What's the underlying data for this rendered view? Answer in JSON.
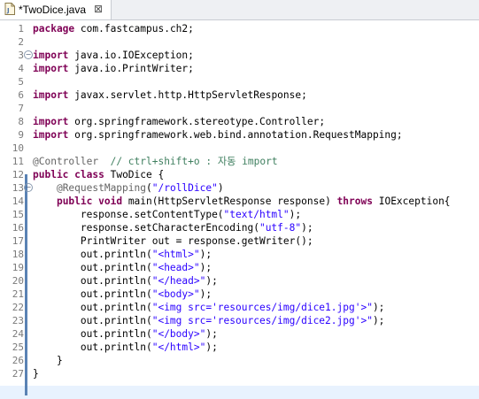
{
  "tab": {
    "title": "*TwoDice.java",
    "close": "⊠"
  },
  "lines": [
    {
      "n": "1",
      "segs": [
        [
          "kw",
          "package"
        ],
        [
          "",
          "com.fastcampus.ch2;"
        ]
      ]
    },
    {
      "n": "2",
      "segs": []
    },
    {
      "n": "3",
      "fold": "−",
      "segs": [
        [
          "kw",
          "import"
        ],
        [
          "",
          "java.io.IOException;"
        ]
      ]
    },
    {
      "n": "4",
      "segs": [
        [
          "kw",
          "import"
        ],
        [
          "",
          "java.io.PrintWriter;"
        ]
      ]
    },
    {
      "n": "5",
      "segs": []
    },
    {
      "n": "6",
      "segs": [
        [
          "kw",
          "import"
        ],
        [
          "",
          "javax.servlet.http.HttpServletResponse;"
        ]
      ]
    },
    {
      "n": "7",
      "segs": []
    },
    {
      "n": "8",
      "segs": [
        [
          "kw",
          "import"
        ],
        [
          "",
          "org.springframework.stereotype.Controller;"
        ]
      ]
    },
    {
      "n": "9",
      "segs": [
        [
          "kw",
          "import"
        ],
        [
          "",
          "org.springframework.web.bind.annotation.RequestMapping;"
        ]
      ]
    },
    {
      "n": "10",
      "segs": []
    },
    {
      "n": "11",
      "segs": [
        [
          "ann",
          "@Controller"
        ],
        [
          "",
          "  "
        ],
        [
          "cm",
          "// ctrl+shift+o : 자동 import"
        ]
      ]
    },
    {
      "n": "12",
      "segs": [
        [
          "kw",
          "public"
        ],
        [
          "",
          " "
        ],
        [
          "kw",
          "class"
        ],
        [
          "",
          " TwoDice {"
        ]
      ]
    },
    {
      "n": "13",
      "fold": "−",
      "segs": [
        [
          "",
          "    "
        ],
        [
          "ann",
          "@RequestMapping"
        ],
        [
          "",
          "("
        ],
        [
          "str",
          "\"/rollDice\""
        ],
        [
          "",
          ")"
        ]
      ]
    },
    {
      "n": "14",
      "segs": [
        [
          "",
          "    "
        ],
        [
          "kw",
          "public"
        ],
        [
          "",
          " "
        ],
        [
          "kw",
          "void"
        ],
        [
          "",
          " main(HttpServletResponse response) "
        ],
        [
          "kw",
          "throws"
        ],
        [
          "",
          " IOException{"
        ]
      ]
    },
    {
      "n": "15",
      "segs": [
        [
          "",
          "        response.setContentType("
        ],
        [
          "str",
          "\"text/html\""
        ],
        [
          "",
          ");"
        ]
      ]
    },
    {
      "n": "16",
      "segs": [
        [
          "",
          "        response.setCharacterEncoding("
        ],
        [
          "str",
          "\"utf-8\""
        ],
        [
          "",
          ");"
        ]
      ]
    },
    {
      "n": "17",
      "segs": [
        [
          "",
          "        PrintWriter out = response.getWriter();"
        ]
      ]
    },
    {
      "n": "18",
      "segs": [
        [
          "",
          "        out.println("
        ],
        [
          "str",
          "\"<html>\""
        ],
        [
          "",
          ");"
        ]
      ]
    },
    {
      "n": "19",
      "segs": [
        [
          "",
          "        out.println("
        ],
        [
          "str",
          "\"<head>\""
        ],
        [
          "",
          ");"
        ]
      ]
    },
    {
      "n": "20",
      "segs": [
        [
          "",
          "        out.println("
        ],
        [
          "str",
          "\"</head>\""
        ],
        [
          "",
          ");"
        ]
      ]
    },
    {
      "n": "21",
      "segs": [
        [
          "",
          "        out.println("
        ],
        [
          "str",
          "\"<body>\""
        ],
        [
          "",
          ");"
        ]
      ]
    },
    {
      "n": "22",
      "segs": [
        [
          "",
          "        out.println("
        ],
        [
          "str",
          "\"<img src='resources/img/dice1.jpg'>\""
        ],
        [
          "",
          ");"
        ]
      ]
    },
    {
      "n": "23",
      "segs": [
        [
          "",
          "        out.println("
        ],
        [
          "str",
          "\"<img src='resources/img/dice2.jpg'>\""
        ],
        [
          "",
          ");"
        ]
      ]
    },
    {
      "n": "24",
      "segs": [
        [
          "",
          "        out.println("
        ],
        [
          "str",
          "\"</body>\""
        ],
        [
          "",
          ");"
        ]
      ]
    },
    {
      "n": "25",
      "segs": [
        [
          "",
          "        out.println("
        ],
        [
          "str",
          "\"</html>\""
        ],
        [
          "",
          ");"
        ]
      ]
    },
    {
      "n": "26",
      "segs": [
        [
          "",
          "    }"
        ]
      ]
    },
    {
      "n": "27",
      "segs": [
        [
          "",
          "}"
        ]
      ]
    }
  ]
}
